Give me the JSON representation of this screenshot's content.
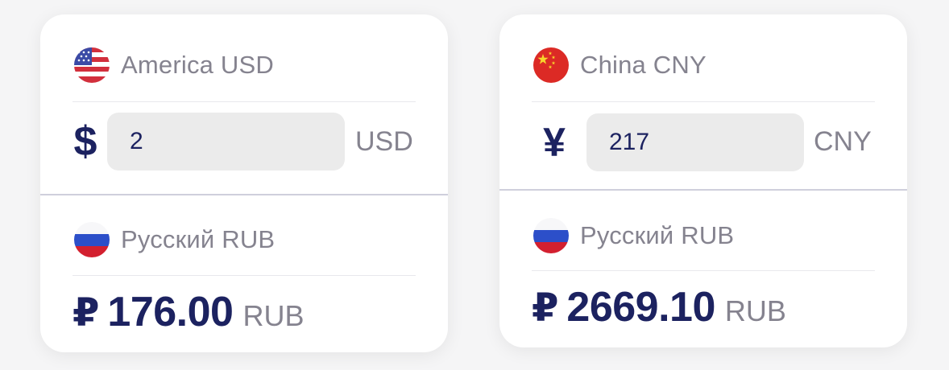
{
  "converters": [
    {
      "from": {
        "name": "America USD",
        "flag": "us-flag-icon",
        "symbol": "$",
        "amount": "2",
        "code": "USD"
      },
      "to": {
        "name": "Русский RUB",
        "flag": "russia-flag-icon",
        "symbol": "₽",
        "result": "176.00",
        "code": "RUB"
      }
    },
    {
      "from": {
        "name": "China CNY",
        "flag": "china-flag-icon",
        "symbol": "¥",
        "amount": "217",
        "code": "CNY"
      },
      "to": {
        "name": "Русский RUB",
        "flag": "russia-flag-icon",
        "symbol": "₽",
        "result": "2669.10",
        "code": "RUB"
      }
    }
  ],
  "colors": {
    "accent": "#1c2260",
    "muted_text": "#85838f",
    "input_bg": "#ebebeb",
    "divider": "#cfcfdc"
  }
}
